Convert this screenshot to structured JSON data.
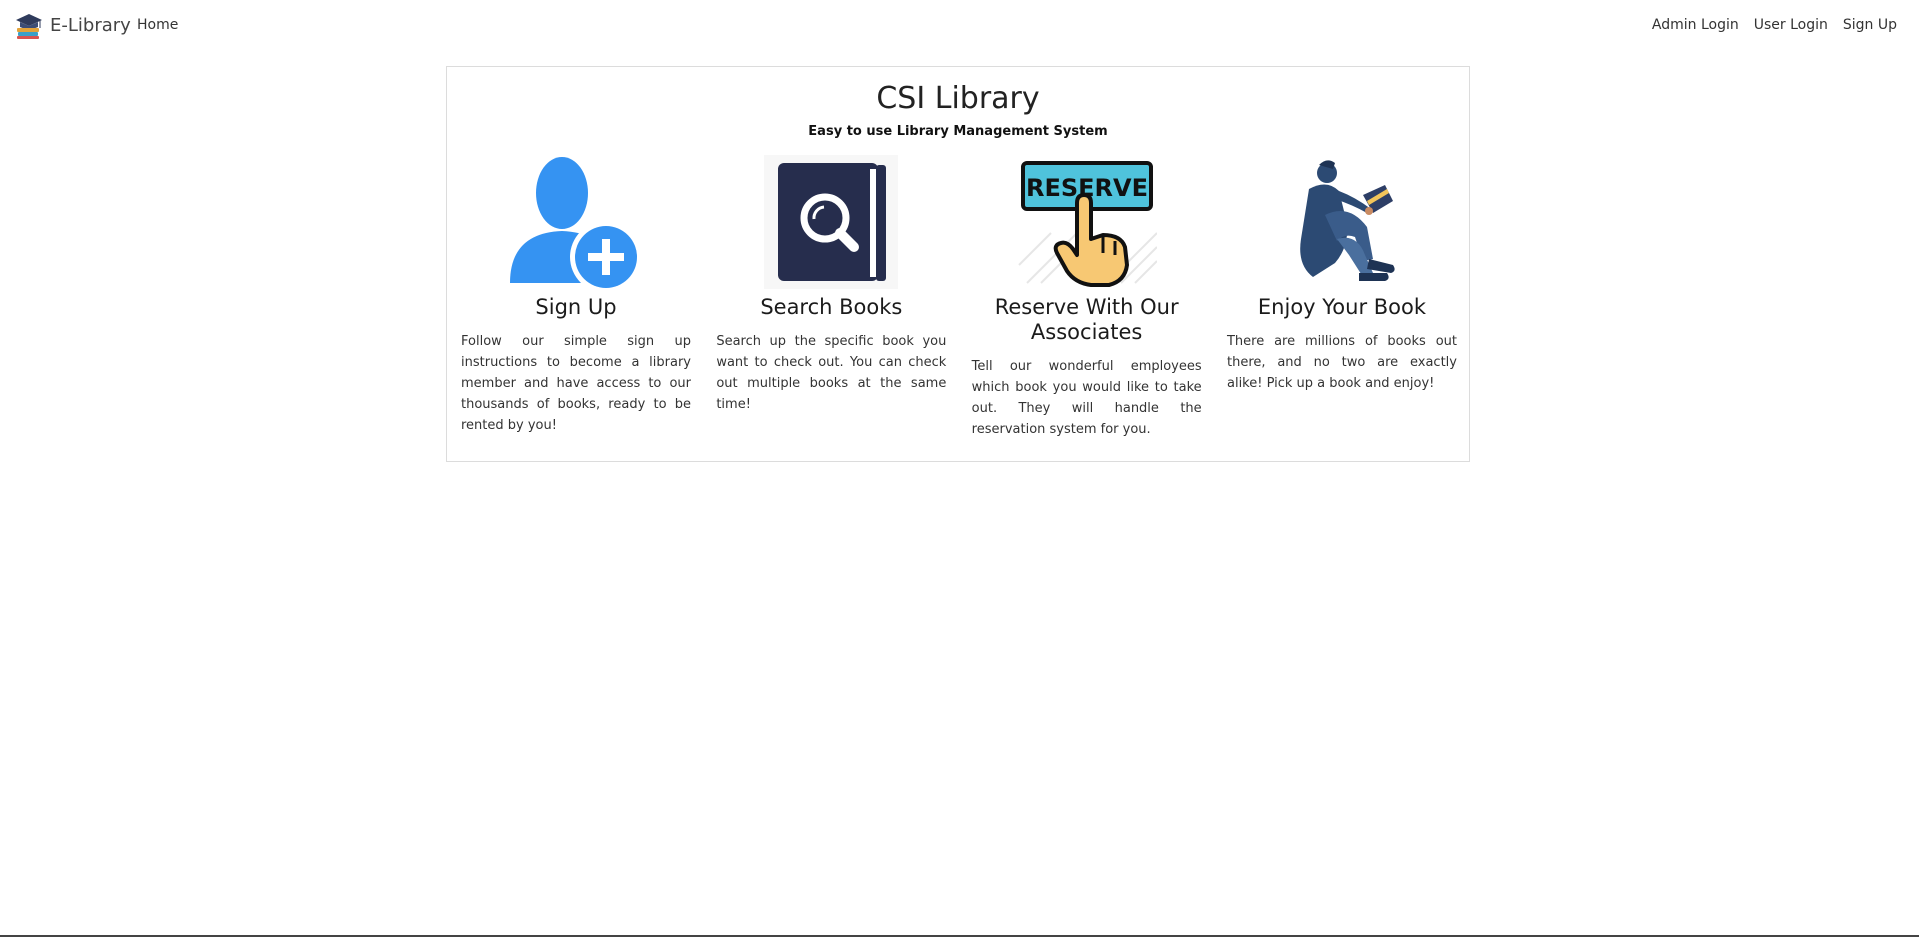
{
  "navbar": {
    "brand": "E-Library",
    "home": "Home",
    "admin_login": "Admin Login",
    "user_login": "User Login",
    "sign_up": "Sign Up"
  },
  "main": {
    "title": "CSI Library",
    "subtitle": "Easy to use Library Management System",
    "features": [
      {
        "title": "Sign Up",
        "text": "Follow our simple sign up instructions to become a library member and have access to our thousands of books, ready to be rented by you!",
        "icon": "add-user-icon"
      },
      {
        "title": "Search Books",
        "text": "Search up the specific book you want to check out. You can check out multiple books at the same time!",
        "icon": "book-search-icon"
      },
      {
        "title": "Reserve With Our Associates",
        "text": "Tell our wonderful employees which book you would like to take out. They will handle the reservation system for you.",
        "icon": "reserve-sign-icon",
        "sign_text": "RESERVE"
      },
      {
        "title": "Enjoy Your Book",
        "text": "There are millions of books out there, and no two are exactly alike! Pick up a book and enjoy!",
        "icon": "person-reading-icon"
      }
    ]
  },
  "colors": {
    "signup_blue": "#3593f2",
    "book_navy": "#262d4d",
    "reserve_cyan": "#4fc3dc",
    "reader_navy": "#2c4a73"
  }
}
